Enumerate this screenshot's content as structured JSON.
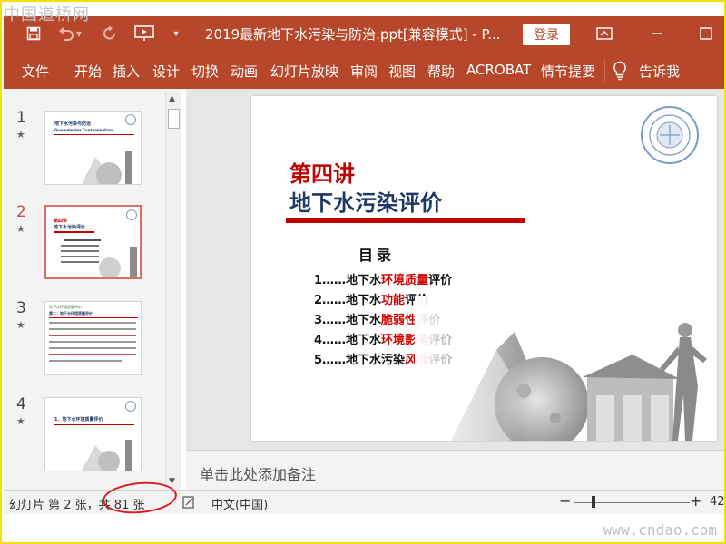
{
  "watermarks": {
    "top": "中国道桥网",
    "bottom": "www.cndao.com"
  },
  "titlebar": {
    "title": "2019最新地下水污染与防治.ppt[兼容模式]  -  P...",
    "login_label": "登录"
  },
  "ribbon": {
    "tabs": [
      "文件",
      "开始",
      "插入",
      "设计",
      "切换",
      "动画",
      "幻灯片放映",
      "审阅",
      "视图",
      "帮助",
      "ACROBAT",
      "情节提要"
    ],
    "tell_me": "告诉我"
  },
  "thumbnails": [
    {
      "number": "1",
      "star": "★",
      "title_line1": "地下水污染与防治",
      "title_line2": "Groundwater Contamination"
    },
    {
      "number": "2",
      "star": "★",
      "title_line1": "第四讲",
      "title_line2": "地下水污染评价",
      "selected": true
    },
    {
      "number": "3",
      "star": "★",
      "title_line1": "地下水环境质量评价",
      "title_line2": "第二：地下水环境质量评价"
    },
    {
      "number": "4",
      "star": "★",
      "title_line1": "1．地下水环境质量评价"
    }
  ],
  "slide": {
    "title_line1": "第四讲",
    "title_line2": "地下水污染评价",
    "toc_heading": "目录",
    "toc_items": [
      {
        "prefix": "1……地下水",
        "highlight": "环境质量",
        "suffix": "评价"
      },
      {
        "prefix": "2……地下水",
        "highlight": "功能",
        "suffix": "评价"
      },
      {
        "prefix": "3……地下水",
        "highlight": "脆弱性",
        "suffix": "评价"
      },
      {
        "prefix": "4……地下水",
        "highlight": "环境影响",
        "suffix": "评价"
      },
      {
        "prefix": "5……地下水污染",
        "highlight": "风险",
        "suffix": "评价"
      }
    ]
  },
  "notes": {
    "placeholder": "单击此处添加备注"
  },
  "statusbar": {
    "slide_info": "幻灯片 第 2 张，共 81 张",
    "language": "中文(中国)",
    "zoom_minus": "−",
    "zoom_plus": "+",
    "zoom_value": "42"
  },
  "colors": {
    "accent": "#b7472a",
    "title_red": "#c00000",
    "title_blue": "#1f3864",
    "highlight_red": "#d40000",
    "annotation_circle": "#e01818"
  },
  "icons": [
    "save-icon",
    "undo-icon",
    "redo-icon",
    "present-icon",
    "customize-icon",
    "ribbon-display-icon",
    "minimize-icon",
    "maximize-icon",
    "lightbulb-icon",
    "notes-icon"
  ]
}
